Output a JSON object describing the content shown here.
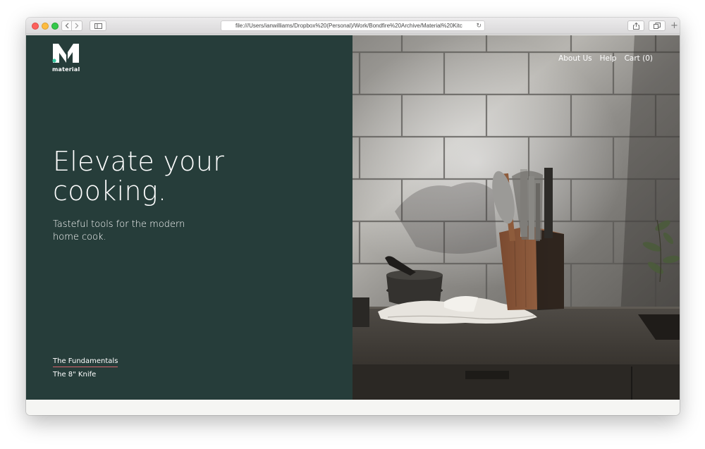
{
  "browser": {
    "url": "file:///Users/ianwilliams/Dropbox%20(Personal)/Work/Bondfire%20Archive/Material%20Kitc",
    "icons": {
      "back": "chevron-left-icon",
      "forward": "chevron-right-icon",
      "sidebar": "sidebar-icon",
      "reload": "reload-icon",
      "share": "share-icon",
      "tabs": "tabs-icon",
      "new_tab": "plus-icon"
    }
  },
  "brand": {
    "logo_icon": "material-logo-icon",
    "name": "material",
    "accent_dot": "#34c8a0"
  },
  "nav": {
    "about": "About Us",
    "help": "Help",
    "cart": "Cart (0)"
  },
  "hero": {
    "title": "Elevate your cooking.",
    "subtitle": "Tasteful tools for the modern home cook."
  },
  "links": {
    "fundamentals": "The Fundamentals",
    "knife": "The 8\" Knife"
  },
  "colors": {
    "panel": "#263d3a",
    "underline": "#d9636c",
    "text": "#ffffff"
  }
}
